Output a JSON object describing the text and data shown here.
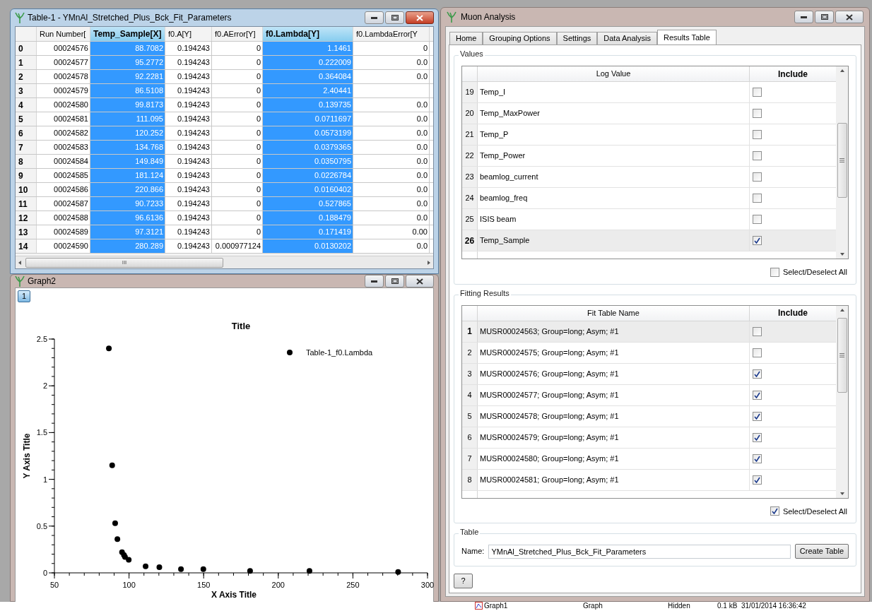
{
  "table_window": {
    "title": "Table-1 - YMnAl_Stretched_Plus_Bck_Fit_Parameters",
    "columns": [
      {
        "label": "Run Number[",
        "selected": false
      },
      {
        "label": "Temp_Sample[X]",
        "selected": true
      },
      {
        "label": "f0.A[Y]",
        "selected": false
      },
      {
        "label": "f0.AError[Y]",
        "selected": false
      },
      {
        "label": "f0.Lambda[Y]",
        "selected": true
      },
      {
        "label": "f0.LambdaError[Y",
        "selected": false
      }
    ],
    "rows": [
      {
        "index": "0",
        "cells": [
          "00024576",
          "88.7082",
          "0.194243",
          "0",
          "1.1461",
          "0"
        ]
      },
      {
        "index": "1",
        "cells": [
          "00024577",
          "95.2772",
          "0.194243",
          "0",
          "0.222009",
          "0.0"
        ]
      },
      {
        "index": "2",
        "cells": [
          "00024578",
          "92.2281",
          "0.194243",
          "0",
          "0.364084",
          "0.0"
        ]
      },
      {
        "index": "3",
        "cells": [
          "00024579",
          "86.5108",
          "0.194243",
          "0",
          "2.40441",
          ""
        ]
      },
      {
        "index": "4",
        "cells": [
          "00024580",
          "99.8173",
          "0.194243",
          "0",
          "0.139735",
          "0.0"
        ]
      },
      {
        "index": "5",
        "cells": [
          "00024581",
          "111.095",
          "0.194243",
          "0",
          "0.0711697",
          "0.0"
        ]
      },
      {
        "index": "6",
        "cells": [
          "00024582",
          "120.252",
          "0.194243",
          "0",
          "0.0573199",
          "0.0"
        ]
      },
      {
        "index": "7",
        "cells": [
          "00024583",
          "134.768",
          "0.194243",
          "0",
          "0.0379365",
          "0.0"
        ]
      },
      {
        "index": "8",
        "cells": [
          "00024584",
          "149.849",
          "0.194243",
          "0",
          "0.0350795",
          "0.0"
        ]
      },
      {
        "index": "9",
        "cells": [
          "00024585",
          "181.124",
          "0.194243",
          "0",
          "0.0226784",
          "0.0"
        ]
      },
      {
        "index": "10",
        "cells": [
          "00024586",
          "220.866",
          "0.194243",
          "0",
          "0.0160402",
          "0.0"
        ]
      },
      {
        "index": "11",
        "cells": [
          "00024587",
          "90.7233",
          "0.194243",
          "0",
          "0.527865",
          "0.0"
        ]
      },
      {
        "index": "12",
        "cells": [
          "00024588",
          "96.6136",
          "0.194243",
          "0",
          "0.188479",
          "0.0"
        ]
      },
      {
        "index": "13",
        "cells": [
          "00024589",
          "97.3121",
          "0.194243",
          "0",
          "0.171419",
          "0.00"
        ]
      },
      {
        "index": "14",
        "cells": [
          "00024590",
          "280.289",
          "0.194243",
          "0.000977124",
          "0.0130202",
          "0.0"
        ]
      }
    ],
    "scroll_grip": "III"
  },
  "graph_window": {
    "title": "Graph2",
    "layer_button": "1",
    "chart_data": {
      "type": "scatter",
      "title": "Title",
      "xlabel": "X Axis Title",
      "ylabel": "Y Axis Title",
      "xlim": [
        50,
        300
      ],
      "ylim": [
        0,
        2.5
      ],
      "xticks": [
        50,
        100,
        150,
        200,
        250,
        300
      ],
      "yticks": [
        0,
        0.5,
        1,
        1.5,
        2,
        2.5
      ],
      "series": [
        {
          "name": "Table-1_f0.Lambda",
          "color": "#000000",
          "x": [
            88.7,
            95.3,
            92.2,
            86.5,
            99.8,
            111.1,
            120.3,
            134.8,
            149.8,
            181.1,
            220.9,
            90.7,
            96.6,
            97.3,
            280.3
          ],
          "values": [
            1.15,
            0.22,
            0.36,
            2.4,
            0.14,
            0.07,
            0.06,
            0.04,
            0.04,
            0.02,
            0.02,
            0.53,
            0.19,
            0.17,
            0.01
          ]
        }
      ]
    }
  },
  "muon_window": {
    "title": "Muon Analysis",
    "tabs": [
      {
        "label": "Home",
        "selected": false
      },
      {
        "label": "Grouping Options",
        "selected": false
      },
      {
        "label": "Settings",
        "selected": false
      },
      {
        "label": "Data Analysis",
        "selected": false
      },
      {
        "label": "Results Table",
        "selected": true
      }
    ],
    "values": {
      "title": "Values",
      "columns": [
        "Log Value",
        "Include"
      ],
      "rows": [
        {
          "number": "19",
          "name": "Temp_I",
          "checked": false,
          "selected": false
        },
        {
          "number": "20",
          "name": "Temp_MaxPower",
          "checked": false,
          "selected": false
        },
        {
          "number": "21",
          "name": "Temp_P",
          "checked": false,
          "selected": false
        },
        {
          "number": "22",
          "name": "Temp_Power",
          "checked": false,
          "selected": false
        },
        {
          "number": "23",
          "name": "beamlog_current",
          "checked": false,
          "selected": false
        },
        {
          "number": "24",
          "name": "beamlog_freq",
          "checked": false,
          "selected": false
        },
        {
          "number": "25",
          "name": "ISIS beam",
          "checked": false,
          "selected": false
        },
        {
          "number": "26",
          "name": "Temp_Sample",
          "checked": true,
          "selected": true
        }
      ],
      "select_all": {
        "label": "Select/Deselect All",
        "checked": false
      }
    },
    "fitting_results": {
      "title": "Fitting Results",
      "columns": [
        "Fit Table Name",
        "Include"
      ],
      "rows": [
        {
          "number": "1",
          "name": "MUSR00024563; Group=long; Asym; #1",
          "checked": false,
          "selected": true
        },
        {
          "number": "2",
          "name": "MUSR00024575; Group=long; Asym; #1",
          "checked": false,
          "selected": false
        },
        {
          "number": "3",
          "name": "MUSR00024576; Group=long; Asym; #1",
          "checked": true,
          "selected": false
        },
        {
          "number": "4",
          "name": "MUSR00024577; Group=long; Asym; #1",
          "checked": true,
          "selected": false
        },
        {
          "number": "5",
          "name": "MUSR00024578; Group=long; Asym; #1",
          "checked": true,
          "selected": false
        },
        {
          "number": "6",
          "name": "MUSR00024579; Group=long; Asym; #1",
          "checked": true,
          "selected": false
        },
        {
          "number": "7",
          "name": "MUSR00024580; Group=long; Asym; #1",
          "checked": true,
          "selected": false
        },
        {
          "number": "8",
          "name": "MUSR00024581; Group=long; Asym; #1",
          "checked": true,
          "selected": false
        }
      ],
      "select_all": {
        "label": "Select/Deselect All",
        "checked": true
      }
    },
    "table": {
      "title": "Table",
      "name_label": "Name:",
      "name_value": "YMnAl_Stretched_Plus_Bck_Fit_Parameters",
      "create_button": "Create Table"
    },
    "help_button": "?"
  },
  "background_list_row": [
    "Graph1",
    "Graph",
    "Hidden",
    "0.1 kB",
    "31/01/2014 16:36:42"
  ]
}
